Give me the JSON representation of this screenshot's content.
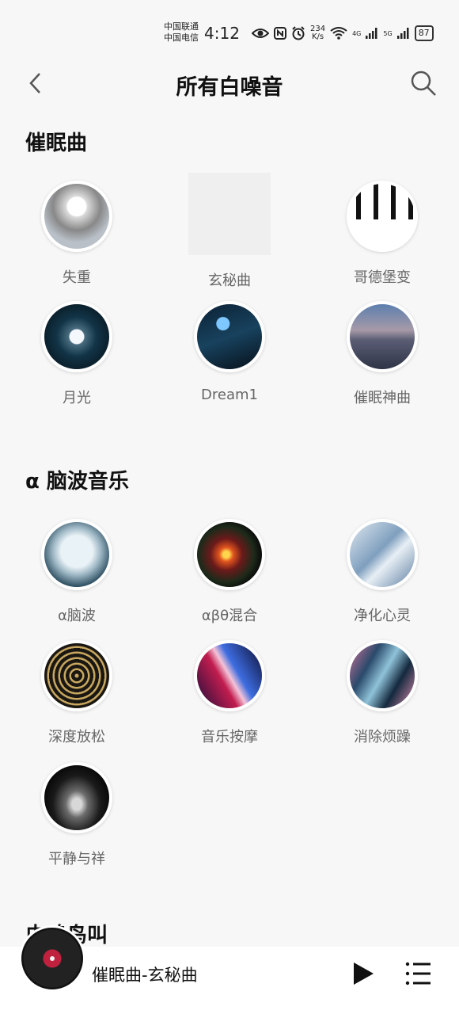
{
  "status": {
    "carrier1": "中国联通",
    "carrier2": "中国电信",
    "time": "4:12",
    "speed_value": "234",
    "speed_unit": "K/s",
    "net1": "4G",
    "net2": "5G",
    "battery": "87",
    "icons": [
      "eye-icon",
      "nfc-icon",
      "alarm-icon",
      "wifi-icon",
      "signal-icon",
      "signal-icon",
      "battery-icon"
    ]
  },
  "header": {
    "title": "所有白噪音",
    "back_icon": "chevron-left-icon",
    "search_icon": "search-icon"
  },
  "sections": [
    {
      "title": "催眠曲",
      "items": [
        "失重",
        "玄秘曲",
        "哥德堡变",
        "月光",
        "Dream1",
        "催眠神曲"
      ]
    },
    {
      "title": "α 脑波音乐",
      "items": [
        "α脑波",
        "αβθ混合",
        "净化心灵",
        "深度放松",
        "音乐按摩",
        "消除烦躁",
        "平静与祥"
      ]
    },
    {
      "title": "虫鸣鸟叫",
      "items": []
    }
  ],
  "player": {
    "now_playing": "催眠曲-玄秘曲",
    "play_icon": "play-icon",
    "list_icon": "playlist-icon"
  },
  "colors": {
    "background": "#f7f7f7",
    "label": "#666666",
    "title": "#111111",
    "disc_center": "#c0213f"
  }
}
